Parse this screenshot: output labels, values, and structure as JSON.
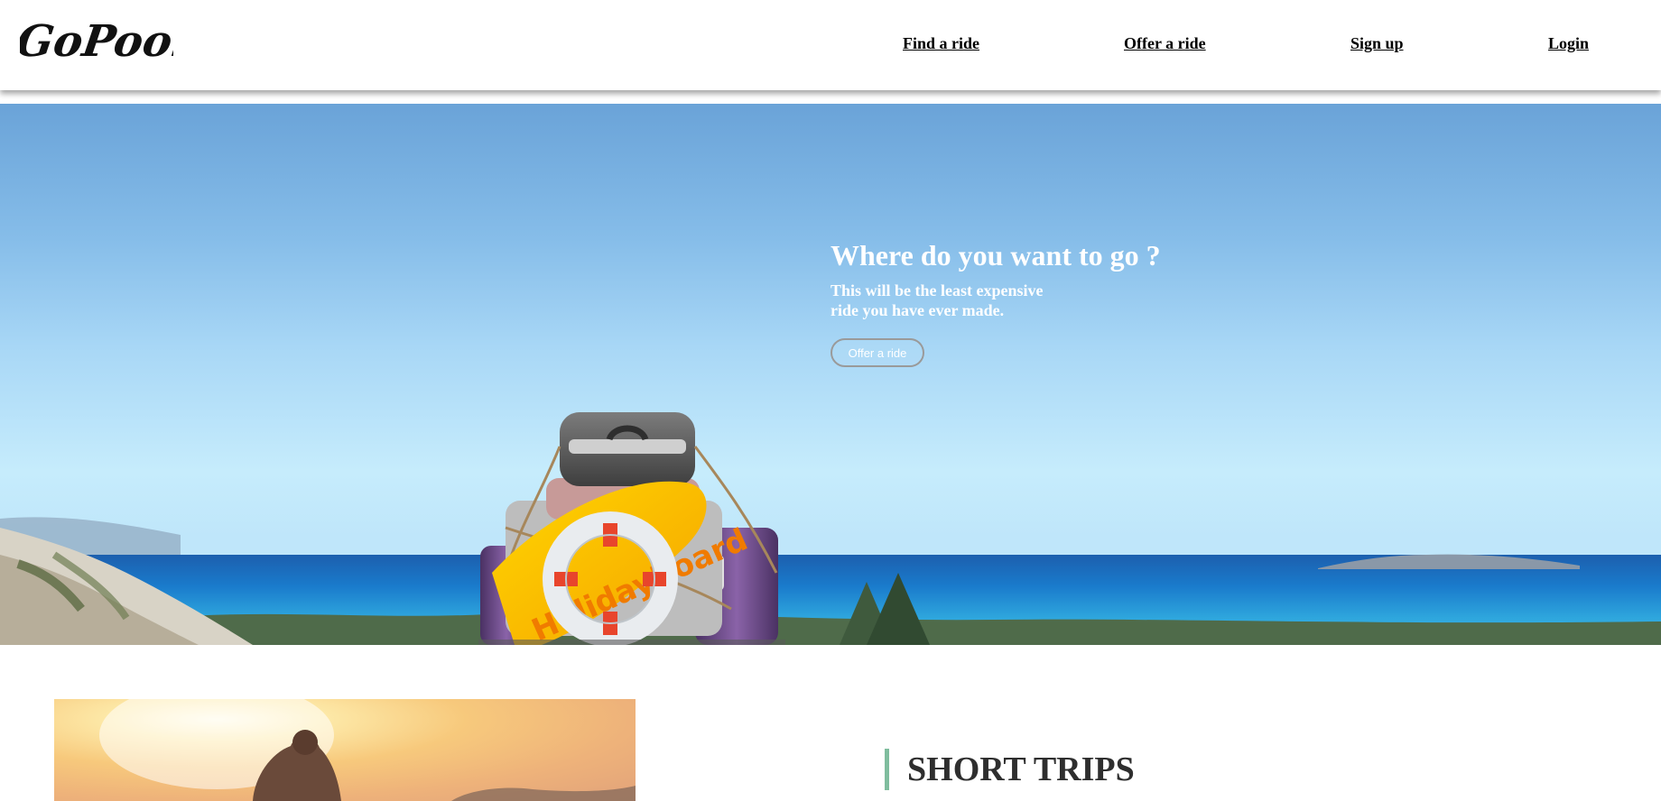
{
  "brand": {
    "logo_text": "GoPool..."
  },
  "nav": {
    "links": [
      {
        "label": "Find a ride"
      },
      {
        "label": "Offer a ride"
      },
      {
        "label": "Sign up"
      },
      {
        "label": "Login"
      }
    ]
  },
  "hero": {
    "title": "Where do you want to go ?",
    "subtitle": "This will be the least expensive ride you have ever made.",
    "button_label": "Offer a ride",
    "image_signage": "HolidayBoard"
  },
  "section": {
    "title": "SHORT TRIPS"
  },
  "colors": {
    "accent_bar": "#7fbd9e",
    "nav_text": "#000000",
    "hero_text": "#ffffff",
    "section_title": "#2e2e2e"
  }
}
